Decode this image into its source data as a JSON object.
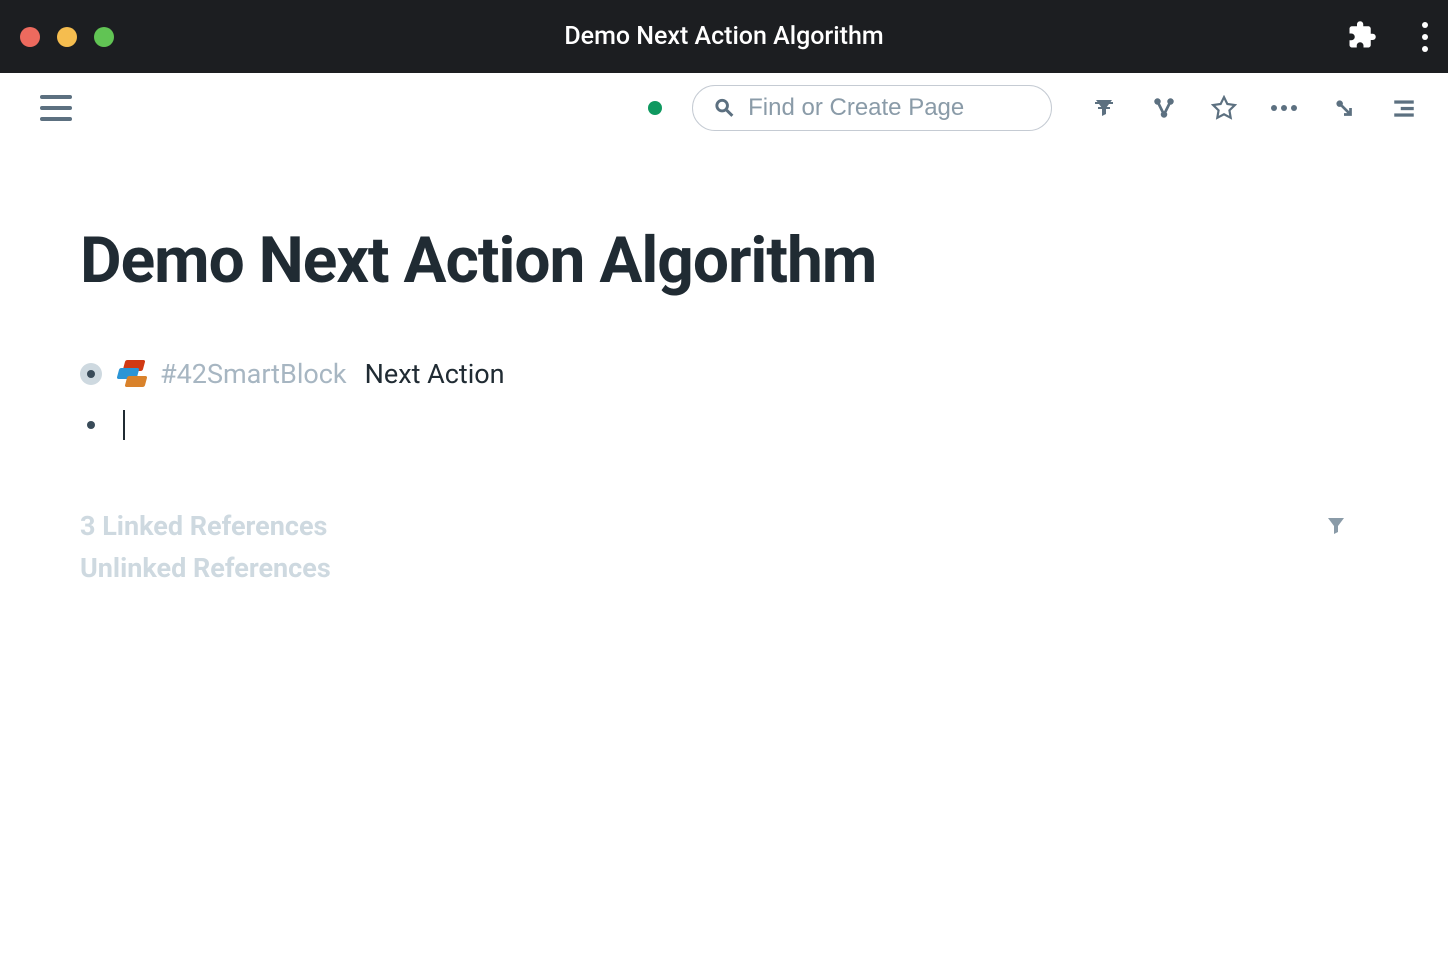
{
  "window": {
    "title": "Demo Next Action Algorithm"
  },
  "toolbar": {
    "search_placeholder": "Find or Create Page"
  },
  "page": {
    "title": "Demo Next Action Algorithm"
  },
  "blocks": [
    {
      "tag": "#42SmartBlock",
      "text": "Next Action"
    }
  ],
  "references": {
    "linked_count": 3,
    "linked_label": "3 Linked References",
    "unlinked_label": "Unlinked References"
  }
}
